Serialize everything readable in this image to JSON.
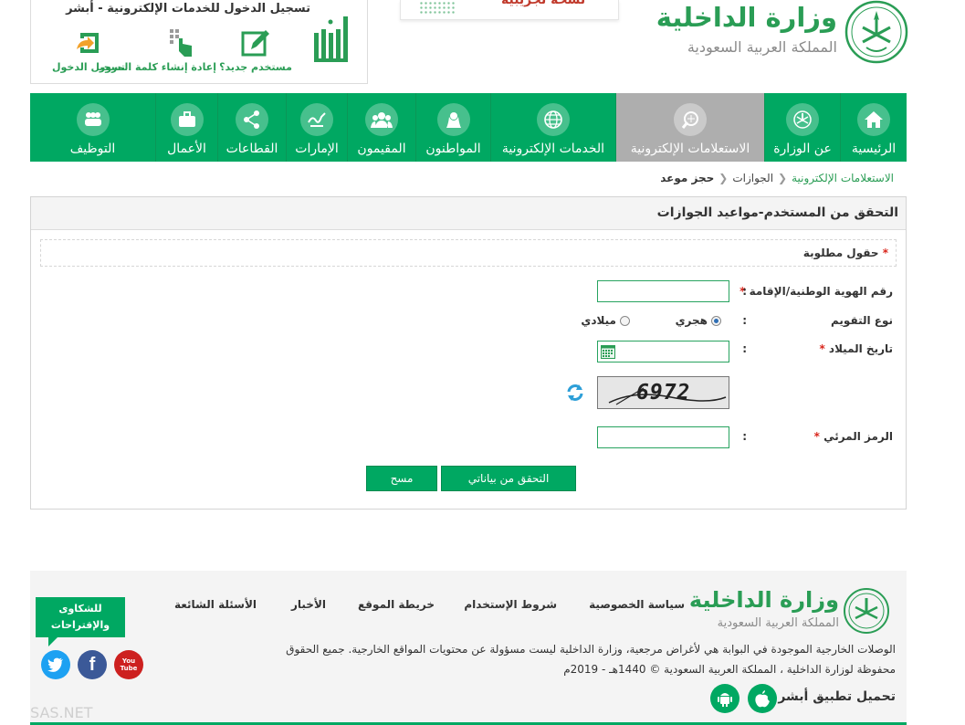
{
  "header": {
    "ministry_name": "وزارة الداخلية",
    "ministry_sub": "المملكة العربية السعودية",
    "center_box_text": "نسخة تجريبية",
    "absher_title": "تسجيل الدخول للخدمات الإلكترونية - أبشر",
    "absher_logo_text": "أبشر",
    "absher_items": [
      {
        "label": "مستخدم جديد؟",
        "icon": "pencil-icon"
      },
      {
        "label": "إعادة إنشاء كلمة المرور",
        "icon": "touch-keypad-icon"
      },
      {
        "label": "تسجيل الدخول",
        "icon": "login-arrow-icon"
      }
    ]
  },
  "nav": {
    "items": [
      {
        "label": "الرئيسية",
        "icon": "home-icon",
        "active": false
      },
      {
        "label": "عن الوزارة",
        "icon": "emblem-icon",
        "active": false
      },
      {
        "label": "الاستعلامات الإلكترونية",
        "icon": "inquiry-icon",
        "active": true
      },
      {
        "label": "الخدمات الإلكترونية",
        "icon": "globe-icon",
        "active": false
      },
      {
        "label": "المواطنون",
        "icon": "citizen-icon",
        "active": false
      },
      {
        "label": "المقيمون",
        "icon": "residents-icon",
        "active": false
      },
      {
        "label": "الإمارات",
        "icon": "emirates-icon",
        "active": false
      },
      {
        "label": "القطاعات",
        "icon": "share-nodes-icon",
        "active": false
      },
      {
        "label": "الأعمال",
        "icon": "briefcase-icon",
        "active": false
      },
      {
        "label": "التوظيف",
        "icon": "team-icon",
        "active": false
      }
    ]
  },
  "breadcrumb": {
    "items": [
      "الاستعلامات الإلكترونية",
      "الجوازات",
      "حجز موعد"
    ]
  },
  "form": {
    "title": "التحقق من المستخدم-مواعيد الجوازات",
    "required_note": "حقول مطلوبة",
    "required_mark": "*",
    "id_label": "رقم الهوية الوطنية/الإقامة",
    "id_value": "",
    "calendar_label": "نوع التقويم",
    "calendar_options": [
      "هجري",
      "ميلادي"
    ],
    "calendar_selected": "هجري",
    "birth_label": "تاريخ الميلاد",
    "birth_value": "",
    "captcha_text": "6972",
    "captcha_label": "الرمز المرئي",
    "captcha_value": "",
    "colon": ":",
    "verify_button": "التحقق من بياناتي",
    "clear_button": "مسح"
  },
  "footer": {
    "ministry_name": "وزارة الداخلية",
    "ministry_sub": "المملكة العربية السعودية",
    "links": [
      "سياسة الخصوصية",
      "شروط الإستخدام",
      "خريطة الموقع",
      "الأخبار",
      "الأسئلة الشائعة"
    ],
    "disclaimer_1": "الوصلات الخارجية الموجودة في البوابة هي لأغراض مرجعية، وزارة الداخلية ليست مسؤولة عن محتويات المواقع الخارجية. جميع الحقوق",
    "disclaimer_2": "محفوظة لوزارة الداخلية ، المملكة العربية السعودية © 1440هـ - 2019م",
    "app_title": "تحميل تطبيق أبشر",
    "complaints": "للشكاوى والإقتراحات",
    "youtube_label": "You Tube",
    "watermark": "SAS.NET",
    "colors": {
      "brand_green": "#00a862",
      "facebook": "#3b5998",
      "twitter": "#1da1f2",
      "youtube": "#cd201f"
    }
  }
}
